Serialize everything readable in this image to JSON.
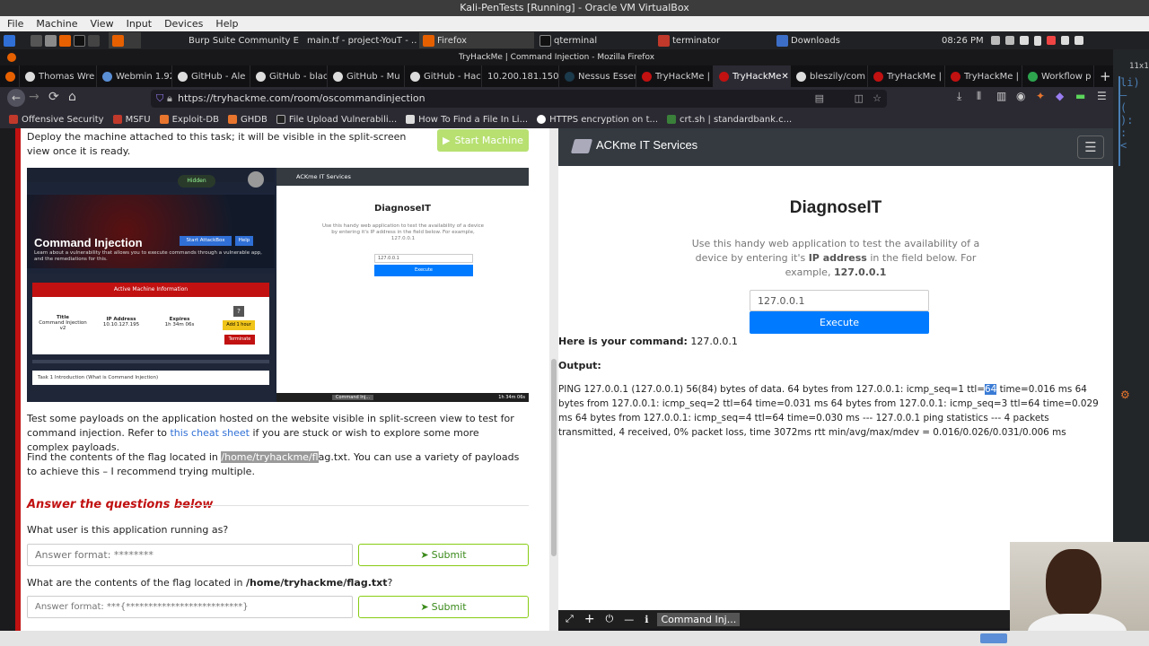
{
  "vbox": {
    "title": "Kali-PenTests [Running] - Oracle VM VirtualBox",
    "menu": [
      "File",
      "Machine",
      "View",
      "Input",
      "Devices",
      "Help"
    ]
  },
  "taskbar": {
    "tasks": [
      "Burp Suite Community E...",
      "main.tf - project-YouT - ...",
      "Firefox",
      "qterminal",
      "terminator",
      "Downloads"
    ],
    "clock": "08:26 PM"
  },
  "firefox": {
    "window_title": "TryHackMe | Command Injection - Mozilla Firefox",
    "tabs": [
      "Thomas Wre",
      "Webmin 1.92",
      "GitHub - Ale",
      "GitHub - blac",
      "GitHub - Mu",
      "GitHub - Hac",
      "10.200.181.150/",
      "Nessus Essen",
      "TryHackMe |",
      "TryHackMe",
      "bleszily/com",
      "TryHackMe |",
      "TryHackMe |",
      "Workflow p"
    ],
    "url": "https://tryhackme.com/room/oscommandinjection",
    "bookmarks": [
      "Offensive Security",
      "MSFU",
      "Exploit-DB",
      "GHDB",
      "File Upload Vulnerabili...",
      "How To Find a File In Li...",
      "HTTPS encryption on t...",
      "crt.sh | standardbank.c..."
    ]
  },
  "task": {
    "deploy_text": "Deploy the machine attached to this task; it will be visible in the split-screen view once it is ready.",
    "start_machine": "Start Machine",
    "thumb": {
      "room_title": "Command Injection",
      "room_desc": "Learn about a vulnerability that allows you to execute commands through a vulnerable app, and the remediations for this.",
      "hidden": "Hidden",
      "start_attackbox": "Start AttackBox",
      "help": "Help",
      "active_machine": "Active Machine Information",
      "title_label": "Title",
      "title_value": "Command Injection v2",
      "ip_label": "IP Address",
      "ip_value": "10.10.127.195",
      "expires_label": "Expires",
      "expires_value": "1h 34m 06s",
      "add_hour": "Add 1 hour",
      "terminate": "Terminate",
      "task_item": "Task 1  Introduction (What is Command Injection)",
      "mini_brand": "ACKme IT Services",
      "mini_title": "DiagnoseIT",
      "mini_desc": "Use this handy web application to test the availability of a device by entering it's IP address in the field below. For example, 127.0.0.1",
      "mini_input": "127.0.0.1",
      "mini_execute": "Execute",
      "mini_tab": "Command Inj...",
      "mini_time": "1h 34m 06s"
    },
    "para1_a": "Test some payloads on the application hosted on the website visible in split-screen view to test for command injection. Refer to ",
    "para1_link": "this cheat sheet",
    "para1_b": " if you are stuck or wish to explore some more complex payloads.",
    "para2_a": "Find the contents of the flag located in ",
    "para2_path": "/home/tryhackme/fl",
    "para2_b": "ag.txt. You can use a variety of payloads to achieve this – I recommend trying multiple.",
    "answer_heading": "Answer the questions below",
    "q1": "What user is this application running as?",
    "q1_placeholder": "Answer format: ********",
    "q2_a": "What are the contents of the flag located in ",
    "q2_path": "/home/tryhackme/flag.txt",
    "q2_b": "?",
    "q2_placeholder": "Answer format: ***{**************************}",
    "submit": "Submit"
  },
  "app": {
    "brand": "ACKme IT Services",
    "title": "DiagnoseIT",
    "desc_a": "Use this handy web application to test the availability of a device by entering it's ",
    "desc_ip": "IP address",
    "desc_b": " in the field below. For example, ",
    "desc_example": "127.0.0.1",
    "input_value": "127.0.0.1",
    "execute": "Execute",
    "command_label": "Here is your command:",
    "command_value": "127.0.0.1",
    "output_label": "Output:",
    "output_a": "PING 127.0.0.1 (127.0.0.1) 56(84) bytes of data. 64 bytes from 127.0.0.1: icmp_seq=1 ttl=",
    "output_sel": "64",
    "output_b": " time=0.016 ms 64 bytes from 127.0.0.1: icmp_seq=2 ttl=64 time=0.031 ms 64 bytes from 127.0.0.1: icmp_seq=3 ttl=64 time=0.029 ms 64 bytes from 127.0.0.1: icmp_seq=4 ttl=64 time=0.030 ms --- 127.0.0.1 ping statistics --- 4 packets transmitted, 4 received, 0% packet loss, time 3072ms rtt min/avg/max/mdev = 0.016/0.026/0.031/0.006 ms",
    "bottom_tab": "Command Inj..."
  },
  "colors": {
    "thm_red": "#c11111",
    "start_green": "#88cc14",
    "execute_blue": "#007bff",
    "nav_dark": "#343a40"
  }
}
